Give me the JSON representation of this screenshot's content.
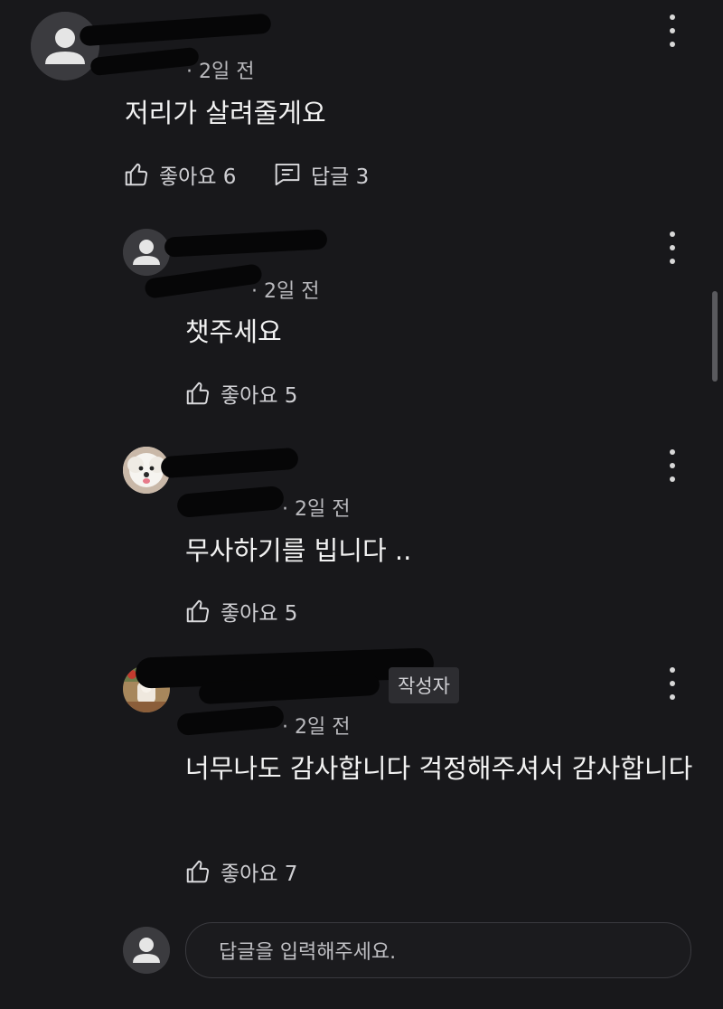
{
  "comment": {
    "username": "",
    "handle": "",
    "time": "· 2일 전",
    "text": "저리가 살려줄게요",
    "likes_label": "좋아요 6",
    "replies_label": "답글 3",
    "icons": {
      "avatar": "default-avatar-icon",
      "like": "thumbs-up-icon",
      "reply": "reply-icon",
      "more": "more-vertical-icon"
    }
  },
  "replies": [
    {
      "username": "",
      "handle": "",
      "time": "· 2일 전",
      "text": "챗주세요",
      "likes_label": "좋아요 5",
      "avatar": "default-avatar-icon"
    },
    {
      "username": "",
      "handle": "",
      "time": "· 2일 전",
      "text": "무사하기를 빕니다 ..",
      "likes_label": "좋아요 5",
      "avatar": "dog-photo-avatar"
    },
    {
      "username": "",
      "handle": "",
      "badge": "작성자",
      "time": "· 2일 전",
      "text": "너무나도 감사합니다 걱정해주셔서 감사합니다",
      "likes_label": "좋아요 7",
      "avatar": "photo-avatar"
    }
  ],
  "reply_input": {
    "placeholder": "답글을 입력해주세요."
  },
  "colors": {
    "background": "#18181b",
    "text": "#ececec",
    "meta": "#b9b9bd",
    "redaction": "#060607"
  }
}
